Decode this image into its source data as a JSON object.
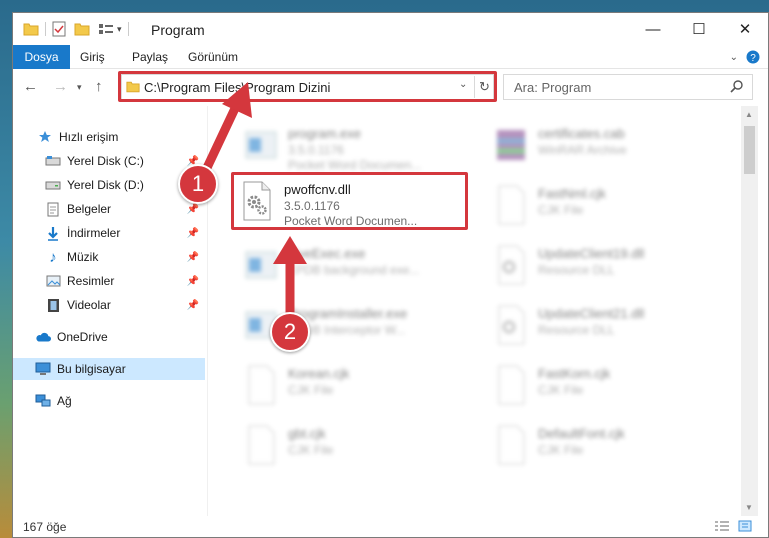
{
  "window": {
    "title": "Program"
  },
  "ribbon": {
    "tabs": [
      "Dosya",
      "Giriş",
      "Paylaş",
      "Görünüm"
    ]
  },
  "address": {
    "path": "C:\\Program Files\\Program Dizini"
  },
  "search": {
    "placeholder": "Ara: Program"
  },
  "sidebar": {
    "items": [
      {
        "label": "Hızlı erişim"
      },
      {
        "label": "Yerel Disk (C:)"
      },
      {
        "label": "Yerel Disk (D:)"
      },
      {
        "label": "Belgeler"
      },
      {
        "label": "İndirmeler"
      },
      {
        "label": "Müzik"
      },
      {
        "label": "Resimler"
      },
      {
        "label": "Videolar"
      },
      {
        "label": "OneDrive"
      },
      {
        "label": "Bu bilgisayar"
      },
      {
        "label": "Ağ"
      }
    ]
  },
  "files": {
    "highlighted": {
      "name": "pwoffcnv.dll",
      "version": "3.5.0.1176",
      "desc": "Pocket Word Documen..."
    },
    "others": [
      {
        "name": "program.exe",
        "l1": "3.5.0.1176",
        "l2": "Pocket Word Documen..."
      },
      {
        "name": "certificates.cab",
        "l1": "WinRAR Archive",
        "l2": ""
      },
      {
        "name": "FastNml.cjk",
        "l1": "CJK File",
        "l2": ""
      },
      {
        "name": "LiveExec.exe",
        "l1": "EPDB background exe...",
        "l2": ""
      },
      {
        "name": "UpdateClient19.dll",
        "l1": "Resource DLL",
        "l2": ""
      },
      {
        "name": "ProgramInstaller.exe",
        "l1": "EPDB Interceptor W...",
        "l2": ""
      },
      {
        "name": "UpdateClient21.dll",
        "l1": "Resource DLL",
        "l2": ""
      },
      {
        "name": "Korean.cjk",
        "l1": "CJK File",
        "l2": ""
      },
      {
        "name": "FastKorn.cjk",
        "l1": "CJK File",
        "l2": ""
      },
      {
        "name": "gbt.cjk",
        "l1": "CJK File",
        "l2": ""
      },
      {
        "name": "DefaultFont.cjk",
        "l1": "CJK File",
        "l2": ""
      }
    ]
  },
  "status": {
    "count": "167 öğe"
  },
  "annotations": {
    "step1": "1",
    "step2": "2"
  },
  "colors": {
    "accent": "#1979ca",
    "highlight": "#d4373d",
    "selection": "#cce8ff"
  }
}
